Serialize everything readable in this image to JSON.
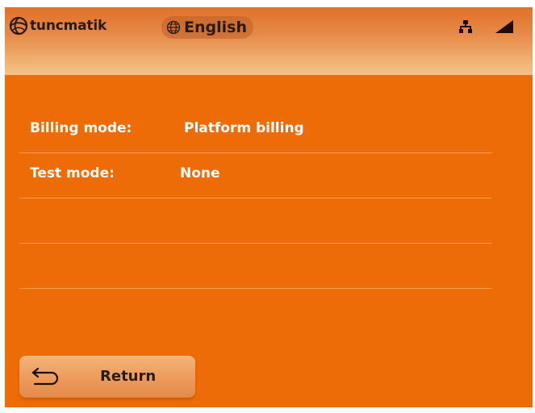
{
  "header": {
    "brand": "tuncmatik",
    "language": "English",
    "icons": {
      "logo": "tuncmatik-logo-icon",
      "globe": "globe-icon",
      "network": "network-icon",
      "signal": "signal-icon"
    }
  },
  "info": {
    "rows": [
      {
        "label": "Billing mode:",
        "value": "Platform billing"
      },
      {
        "label": "Test mode:",
        "value": "None"
      },
      {
        "label": "",
        "value": ""
      },
      {
        "label": "",
        "value": ""
      }
    ]
  },
  "footer": {
    "return_label": "Return",
    "return_icon": "return-arrow-icon"
  },
  "colors": {
    "background": "#ee6c07",
    "text": "#ffffff",
    "button": "#ec9a5a"
  }
}
